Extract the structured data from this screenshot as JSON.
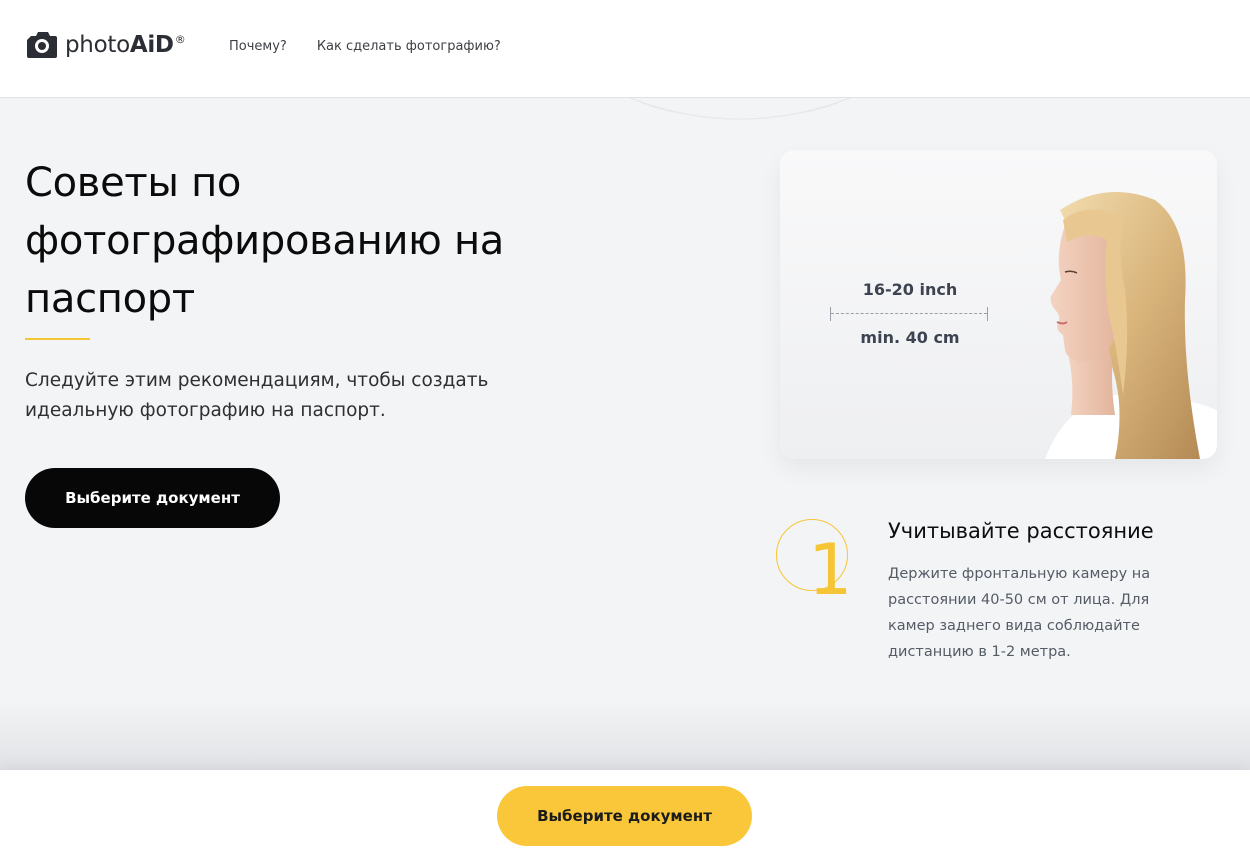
{
  "header": {
    "logo_text": "photo",
    "logo_text_bold": "AiD",
    "logo_reg": "®",
    "nav": [
      {
        "label": "Почему?"
      },
      {
        "label": "Как сделать фотографию?"
      }
    ]
  },
  "hero": {
    "title": "Советы по фотографированию на паспорт",
    "description": "Следуйте этим рекомендациям, чтобы создать идеальную фотографию на паспорт.",
    "button_label": "Выберите документ"
  },
  "illustration": {
    "distance_inch": "16-20 inch",
    "distance_cm": "min. 40 cm"
  },
  "step": {
    "number": "1",
    "title": "Учитывайте расстояние",
    "text": "Держите фронтальную камеру на расстоянии 40-50 см от лица. Для камер заднего вида соблюдайте дистанцию в 1-2 метра."
  },
  "bottom_bar": {
    "button_label": "Выберите документ"
  },
  "colors": {
    "accent": "#f6c536",
    "dark": "#070707",
    "background": "#f3f4f6"
  }
}
